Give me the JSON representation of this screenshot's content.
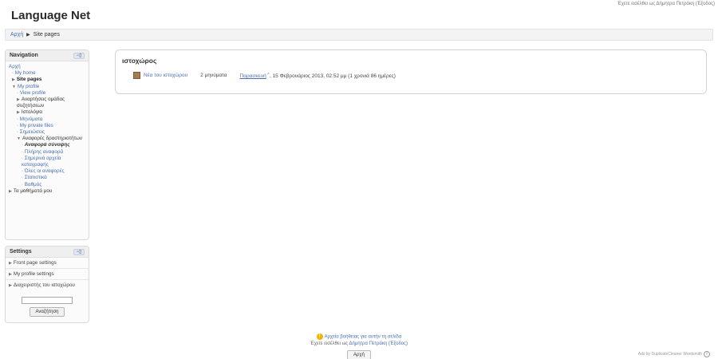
{
  "header": {
    "site_title": "Language Net",
    "login_info": "Έχετε εισέλθει ως Δήμητρα Πετράκη (Έξοδος)"
  },
  "breadcrumb": {
    "home": "Αρχή",
    "separator": "▶",
    "current": "Site pages"
  },
  "navigation": {
    "title": "Navigation",
    "items": [
      {
        "label": "Αρχή"
      },
      {
        "label": "My home"
      },
      {
        "label": "Site pages"
      },
      {
        "label": "My profile"
      },
      {
        "label": "View profile"
      },
      {
        "label": "Αναρτήσεις ομάδας συζητήσεων"
      },
      {
        "label": "Ιστολόγια"
      },
      {
        "label": "Μηνύματα"
      },
      {
        "label": "My private files"
      },
      {
        "label": "Σημειώσεις"
      },
      {
        "label": "Αναφορές δραστηριοτήτων"
      },
      {
        "label": "Αναφορά σύνοψης"
      },
      {
        "label": "Πλήρης αναφορά"
      },
      {
        "label": "Σημερινά αρχεία καταγραφής"
      },
      {
        "label": "Όλες οι αναφορές"
      },
      {
        "label": "Στατιστικά"
      },
      {
        "label": "Βαθμός"
      },
      {
        "label": "Τα μαθήματά μου"
      }
    ]
  },
  "settings": {
    "title": "Settings",
    "items": [
      {
        "label": "Front page settings"
      },
      {
        "label": "My profile settings"
      },
      {
        "label": "Διαχειριστής του ιστοχώρου"
      }
    ],
    "search_button": "Αναζήτηση"
  },
  "main": {
    "title": "ιστοχώρος",
    "row": {
      "name": "Νέα του ιστοχώρου",
      "count": "2 μηνύματα",
      "day": "Παρασκευή",
      "date": ", 15 Φεβρουάριος 2013, 02:52 μμ (1 χρονιά 86 ημέρες)"
    }
  },
  "footer": {
    "help_link": "Αρχεία βοήθειας για αυτήν τη σελίδα",
    "login_prefix": "Έχετε εισέλθει ως ",
    "user_name": "Δήμητρα Πετράκη",
    "logout": "(Έξοδος)",
    "home_button": "Αρχή"
  },
  "poweredby": {
    "text": "Ads by DuplicateCleaner ",
    "brand": "Wordsmith"
  },
  "colors": {
    "link": "#4a6fb3",
    "block_border": "#d9d9d9"
  }
}
